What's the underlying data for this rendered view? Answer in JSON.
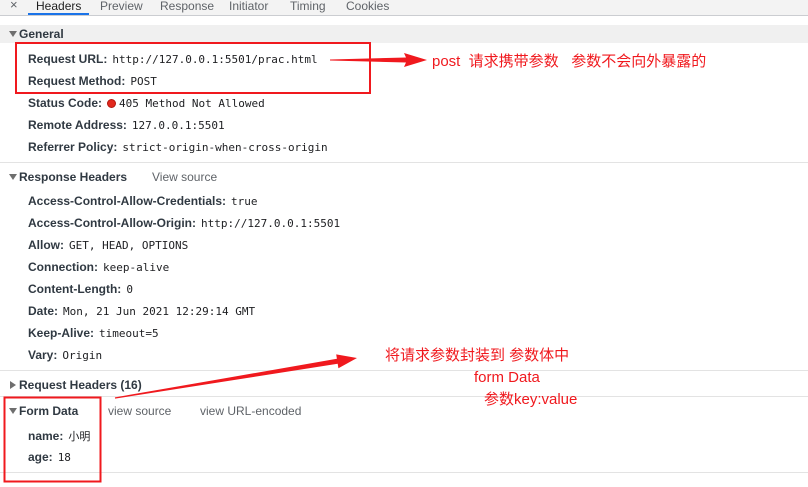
{
  "colors": {
    "annotation_red": "#f0191e",
    "status_error": "#e2281d",
    "selected_tab_accent": "#1a73e8",
    "link_gray": "#5f6368"
  },
  "tabs": {
    "close_glyph": "×",
    "items": [
      {
        "label": "Headers",
        "selected": true
      },
      {
        "label": "Preview"
      },
      {
        "label": "Response"
      },
      {
        "label": "Initiator"
      },
      {
        "label": "Timing"
      },
      {
        "label": "Cookies"
      }
    ]
  },
  "general": {
    "title": "General",
    "expanded": true,
    "rows": [
      {
        "key": "Request URL:",
        "value": "http://127.0.0.1:5501/prac.html"
      },
      {
        "key": "Request Method:",
        "value": "POST"
      },
      {
        "key": "Status Code:",
        "value": "405 Method Not Allowed",
        "status_icon": "red-status-dot-icon"
      },
      {
        "key": "Remote Address:",
        "value": "127.0.0.1:5501"
      },
      {
        "key": "Referrer Policy:",
        "value": "strict-origin-when-cross-origin"
      }
    ]
  },
  "response_headers": {
    "title": "Response Headers",
    "expanded": true,
    "view_source": "View source",
    "rows": [
      {
        "key": "Access-Control-Allow-Credentials:",
        "value": "true"
      },
      {
        "key": "Access-Control-Allow-Origin:",
        "value": "http://127.0.0.1:5501"
      },
      {
        "key": "Allow:",
        "value": "GET, HEAD, OPTIONS"
      },
      {
        "key": "Connection:",
        "value": "keep-alive"
      },
      {
        "key": "Content-Length:",
        "value": "0"
      },
      {
        "key": "Date:",
        "value": "Mon, 21 Jun 2021 12:29:14 GMT"
      },
      {
        "key": "Keep-Alive:",
        "value": "timeout=5"
      },
      {
        "key": "Vary:",
        "value": "Origin"
      }
    ]
  },
  "request_headers": {
    "title": "Request Headers (16)",
    "expanded": false
  },
  "form_data": {
    "title": "Form Data",
    "expanded": true,
    "view_source": "view source",
    "view_url_encoded": "view URL-encoded",
    "rows": [
      {
        "key": "name:",
        "value": "小明"
      },
      {
        "key": "age:",
        "value": "18"
      }
    ]
  },
  "annotations": {
    "note_1": "post  请求携带参数   参数不会向外暴露的",
    "note_2": [
      "将请求参数封装到 参数体中",
      "form Data",
      "参数key:value"
    ]
  }
}
